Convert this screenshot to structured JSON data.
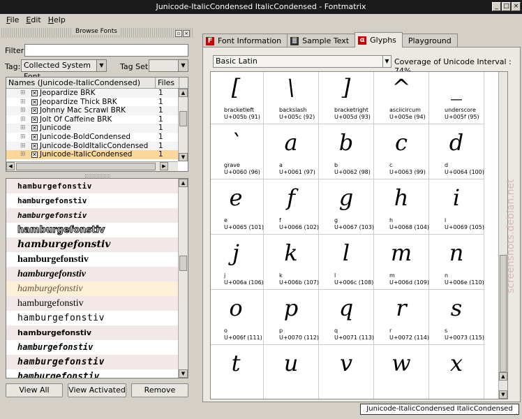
{
  "window": {
    "title": "Junicode-ItalicCondensed ItalicCondensed - Fontmatrix"
  },
  "menu": [
    "File",
    "Edit",
    "Help"
  ],
  "browse": {
    "title": "Browse Fonts",
    "filter_label": "Filter:",
    "filter_value": "",
    "tag_label": "Tag:",
    "tag_value": "Collected System Font",
    "tagset_label": "Tag Set:",
    "tagset_value": "",
    "columns": [
      "Names (Junicode-ItalicCondensed)",
      "Files"
    ],
    "fonts": [
      {
        "name": "Jeopardize BRK",
        "files": "1",
        "selected": false
      },
      {
        "name": "Jeopardize Thick BRK",
        "files": "1",
        "selected": false
      },
      {
        "name": "Johnny Mac Scrawl BRK",
        "files": "1",
        "selected": false
      },
      {
        "name": "Jolt Of Caffeine BRK",
        "files": "1",
        "selected": false
      },
      {
        "name": "Junicode",
        "files": "1",
        "selected": false
      },
      {
        "name": "Junicode-BoldCondensed",
        "files": "1",
        "selected": false
      },
      {
        "name": "Junicode-BoldItalicCondensed",
        "files": "1",
        "selected": false
      },
      {
        "name": "Junicode-ItalicCondensed",
        "files": "1",
        "selected": true
      }
    ]
  },
  "preview": {
    "sample": "hamburgefonstiv",
    "rows": [
      {
        "style": "font-family:'DejaVu Sans Mono',monospace;font-weight:bold;letter-spacing:0.5px;font-size:11px;",
        "selected": false
      },
      {
        "style": "font-family:'DejaVu Sans Mono',monospace;font-weight:bold;font-size:11px;",
        "selected": false
      },
      {
        "style": "font-family:'DejaVu Sans Mono',monospace;font-style:italic;font-weight:bold;font-size:11px;",
        "selected": false
      },
      {
        "style": "font-family:'DejaVu Sans',sans-serif;font-weight:bold;font-size:13px;color:#fff;-webkit-text-stroke:1px #000;",
        "selected": false
      },
      {
        "style": "font-family:'DejaVu Serif',serif;font-style:italic;font-weight:bold;font-size:14px;",
        "selected": false
      },
      {
        "style": "font-family:'Liberation Serif',serif;font-weight:bold;font-size:14px;",
        "selected": false
      },
      {
        "style": "font-family:'Liberation Serif',serif;font-style:italic;font-weight:bold;font-size:14px;",
        "selected": false
      },
      {
        "style": "font-family:'Liberation Serif',serif;font-style:italic;font-size:14px;",
        "selected": true
      },
      {
        "style": "font-family:'Liberation Serif',serif;font-size:14px;",
        "selected": false
      },
      {
        "style": "font-family:'DejaVu Sans Mono',monospace;font-size:13px;letter-spacing:0.5px;",
        "selected": false
      },
      {
        "style": "font-family:'DejaVu Sans',sans-serif;font-weight:bold;font-size:11px;",
        "selected": false
      },
      {
        "style": "font-family:'DejaVu Sans Mono',monospace;font-style:italic;font-weight:bold;font-size:12px;",
        "selected": false
      },
      {
        "style": "font-family:'DejaVu Sans Mono',monospace;font-style:italic;font-weight:bold;font-size:13px;letter-spacing:0.5px;",
        "selected": false
      },
      {
        "style": "font-family:'DejaVu Sans Mono',monospace;font-style:italic;font-weight:bold;font-size:13px;",
        "selected": false
      }
    ]
  },
  "buttons": {
    "view_all": "View All",
    "view_activated": "View Activated",
    "remove": "Remove"
  },
  "tabs": [
    {
      "label": "Font Information",
      "icon": "font-info-icon",
      "glyph": "F",
      "active": false
    },
    {
      "label": "Sample Text",
      "icon": "sample-text-icon",
      "glyph": "≣",
      "active": false
    },
    {
      "label": "Glyphs",
      "icon": "glyphs-icon",
      "glyph": "α",
      "active": true
    },
    {
      "label": "Playground",
      "icon": "",
      "glyph": "",
      "active": false
    }
  ],
  "glyphs_panel": {
    "block": "Basic Latin",
    "coverage": "Coverage of Unicode Interval : 74%",
    "glyphs": [
      {
        "char": "[",
        "name": "bracketleft",
        "code": "U+005b (91)"
      },
      {
        "char": "\\",
        "name": "backslash",
        "code": "U+005c (92)"
      },
      {
        "char": "]",
        "name": "bracketright",
        "code": "U+005d (93)"
      },
      {
        "char": "^",
        "name": "asciicircum",
        "code": "U+005e (94)"
      },
      {
        "char": "_",
        "name": "underscore",
        "code": "U+005f (95)"
      },
      {
        "char": "`",
        "name": "grave",
        "code": "U+0060 (96)"
      },
      {
        "char": "a",
        "name": "a",
        "code": "U+0061 (97)"
      },
      {
        "char": "b",
        "name": "b",
        "code": "U+0062 (98)"
      },
      {
        "char": "c",
        "name": "c",
        "code": "U+0063 (99)"
      },
      {
        "char": "d",
        "name": "d",
        "code": "U+0064 (100)"
      },
      {
        "char": "e",
        "name": "e",
        "code": "U+0065 (101)"
      },
      {
        "char": "f",
        "name": "f",
        "code": "U+0066 (102)"
      },
      {
        "char": "g",
        "name": "g",
        "code": "U+0067 (103)"
      },
      {
        "char": "h",
        "name": "h",
        "code": "U+0068 (104)"
      },
      {
        "char": "i",
        "name": "i",
        "code": "U+0069 (105)"
      },
      {
        "char": "j",
        "name": "j",
        "code": "U+006a (106)"
      },
      {
        "char": "k",
        "name": "k",
        "code": "U+006b (107)"
      },
      {
        "char": "l",
        "name": "l",
        "code": "U+006c (108)"
      },
      {
        "char": "m",
        "name": "m",
        "code": "U+006d (109)"
      },
      {
        "char": "n",
        "name": "n",
        "code": "U+006e (110)"
      },
      {
        "char": "o",
        "name": "o",
        "code": "U+006f (111)"
      },
      {
        "char": "p",
        "name": "p",
        "code": "U+0070 (112)"
      },
      {
        "char": "q",
        "name": "q",
        "code": "U+0071 (113)"
      },
      {
        "char": "r",
        "name": "r",
        "code": "U+0072 (114)"
      },
      {
        "char": "s",
        "name": "s",
        "code": "U+0073 (115)"
      },
      {
        "char": "t",
        "name": "",
        "code": ""
      },
      {
        "char": "u",
        "name": "",
        "code": ""
      },
      {
        "char": "v",
        "name": "",
        "code": ""
      },
      {
        "char": "w",
        "name": "",
        "code": ""
      },
      {
        "char": "x",
        "name": "",
        "code": ""
      }
    ]
  },
  "statusbar": {
    "text": "Junicode-ItalicCondensed ItalicCondensed"
  },
  "watermark": "screenshots.debian.net"
}
